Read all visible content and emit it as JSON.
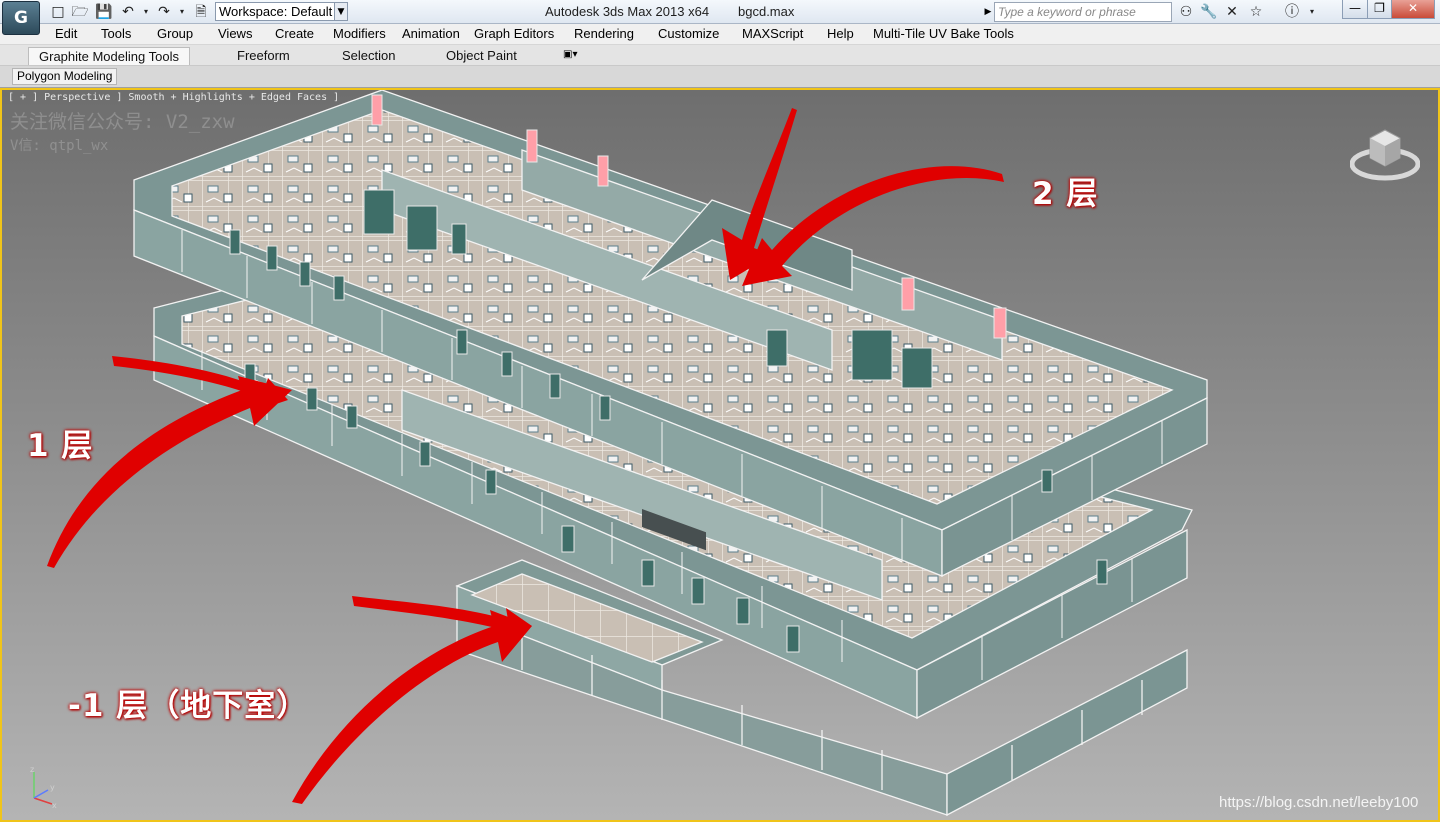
{
  "titlebar": {
    "app_title": "Autodesk 3ds Max  2013 x64",
    "file_name": "bgcd.max",
    "workspace_value": "Workspace: Default",
    "search_placeholder": "Type a keyword or phrase"
  },
  "menubar": {
    "items": [
      "Edit",
      "Tools",
      "Group",
      "Views",
      "Create",
      "Modifiers",
      "Animation",
      "Graph Editors",
      "Rendering",
      "Customize",
      "MAXScript",
      "Help",
      "Multi-Tile UV Bake Tools"
    ]
  },
  "ribbon": {
    "tabs": [
      "Graphite Modeling Tools",
      "Freeform",
      "Selection",
      "Object Paint"
    ],
    "panel": "Polygon Modeling"
  },
  "viewport": {
    "label": "[ + ] Perspective ] Smooth + Highlights + Edged Faces ]",
    "watermark_line1": "关注微信公众号: V2_zxw",
    "watermark_line2": "V信: qtpl_wx",
    "annotations": {
      "floor_2": "2 层",
      "floor_1": "1 层",
      "basement": "-1 层（地下室）"
    },
    "credit": "https://blog.csdn.net/leeby100",
    "accent_color": "#f0c419",
    "arrow_color": "#e00000"
  }
}
